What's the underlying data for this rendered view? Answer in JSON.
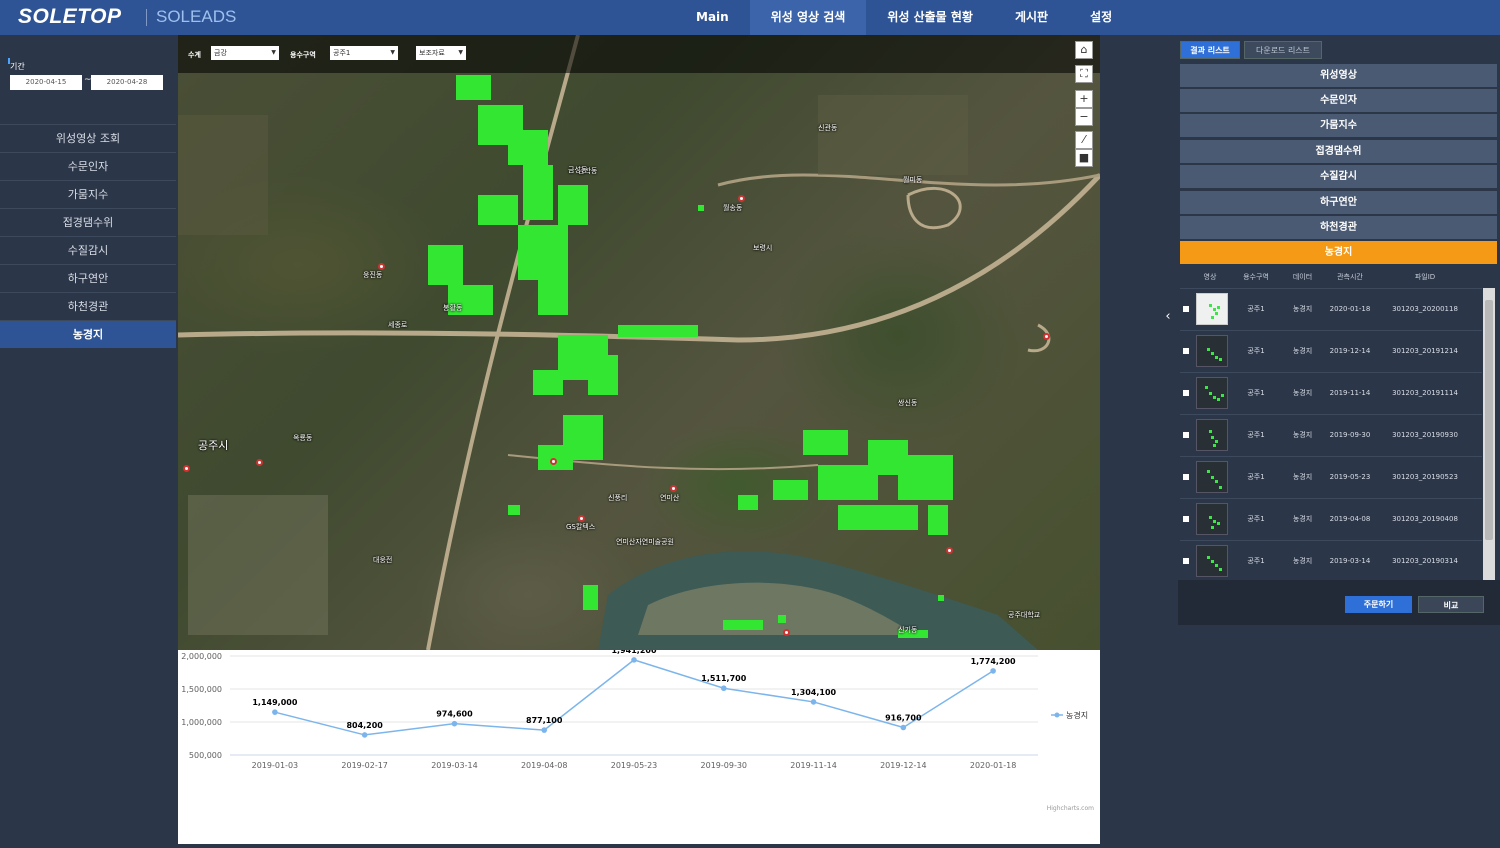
{
  "header": {
    "logo": "SOLETOP",
    "product": "SOLEADS",
    "nav": [
      "Main",
      "위성 영상 검색",
      "위성 산출물 현황",
      "게시판",
      "설정"
    ],
    "active_nav": 1
  },
  "left": {
    "period_label": "기간",
    "date_from": "2020-04-15",
    "date_to": "2020-04-28",
    "tilde": "~",
    "menu": [
      "위성영상 조회",
      "수문인자",
      "가뭄지수",
      "접경댐수위",
      "수질감시",
      "하구연안",
      "하천경관",
      "농경지"
    ],
    "active_menu": 7
  },
  "map": {
    "toolbar": {
      "watershed_label": "수계",
      "watershed_value": "금강",
      "area_label": "용수구역",
      "area_value": "공주1",
      "aux_value": "보조자료"
    },
    "labels": [
      "신관동",
      "금학동",
      "월송동",
      "보령시",
      "웅진동",
      "공주시",
      "신풍리",
      "옥룡동",
      "쌍신동",
      "월미동",
      "금성동",
      "봉황동",
      "연미산",
      "연미산자연미술공원",
      "대웅전",
      "GS칼텍스",
      "세종로",
      "신기동",
      "공주대학교"
    ],
    "icon_names": [
      "home-icon",
      "fullscreen-icon",
      "zoom-in-icon",
      "zoom-out-icon",
      "measure-line-icon",
      "measure-area-icon"
    ]
  },
  "chart_data": {
    "type": "line",
    "categories": [
      "2019-01-03",
      "2019-02-17",
      "2019-03-14",
      "2019-04-08",
      "2019-05-23",
      "2019-09-30",
      "2019-11-14",
      "2019-12-14",
      "2020-01-18"
    ],
    "series": [
      {
        "name": "농경지",
        "values": [
          1149000,
          804200,
          974600,
          877100,
          1941200,
          1511700,
          1304100,
          916700,
          1774200
        ],
        "color": "#7cb5ec"
      }
    ],
    "value_labels": [
      "1,149,000",
      "804,200",
      "974,600",
      "877,100",
      "1,941,200",
      "1,511,700",
      "1,304,100",
      "916,700",
      "1,774,200"
    ],
    "ylim": [
      500000,
      2000000
    ],
    "yticks": [
      500000,
      1000000,
      1500000,
      2000000
    ],
    "ytick_labels": [
      "500,000",
      "1,000,000",
      "1,500,000",
      "2,000,000"
    ],
    "legend_position": "right",
    "credit": "Highcharts.com"
  },
  "right": {
    "tabs": [
      "결과 리스트",
      "다운로드 리스트"
    ],
    "categories": [
      "위성영상",
      "수문인자",
      "가뭄지수",
      "접경댐수위",
      "수질감시",
      "하구연안",
      "하천경관",
      "농경지"
    ],
    "active_category": 7,
    "table_headers": [
      "영상",
      "용수구역",
      "데이터",
      "관측시간",
      "파일ID"
    ],
    "rows": [
      {
        "area": "공주1",
        "data": "농경지",
        "date": "2020-01-18",
        "file": "301203_20200118"
      },
      {
        "area": "공주1",
        "data": "농경지",
        "date": "2019-12-14",
        "file": "301203_20191214"
      },
      {
        "area": "공주1",
        "data": "농경지",
        "date": "2019-11-14",
        "file": "301203_20191114"
      },
      {
        "area": "공주1",
        "data": "농경지",
        "date": "2019-09-30",
        "file": "301203_20190930"
      },
      {
        "area": "공주1",
        "data": "농경지",
        "date": "2019-05-23",
        "file": "301203_20190523"
      },
      {
        "area": "공주1",
        "data": "농경지",
        "date": "2019-04-08",
        "file": "301203_20190408"
      },
      {
        "area": "공주1",
        "data": "농경지",
        "date": "2019-03-14",
        "file": "301203_20190314"
      }
    ],
    "order_button": "주문하기",
    "compare_button": "비교"
  },
  "colors": {
    "header": "#2f5496",
    "panel": "#2b3648",
    "active_category": "#f59a16",
    "primary_button": "#2f6fd8",
    "overlay_green": "#32e632"
  }
}
